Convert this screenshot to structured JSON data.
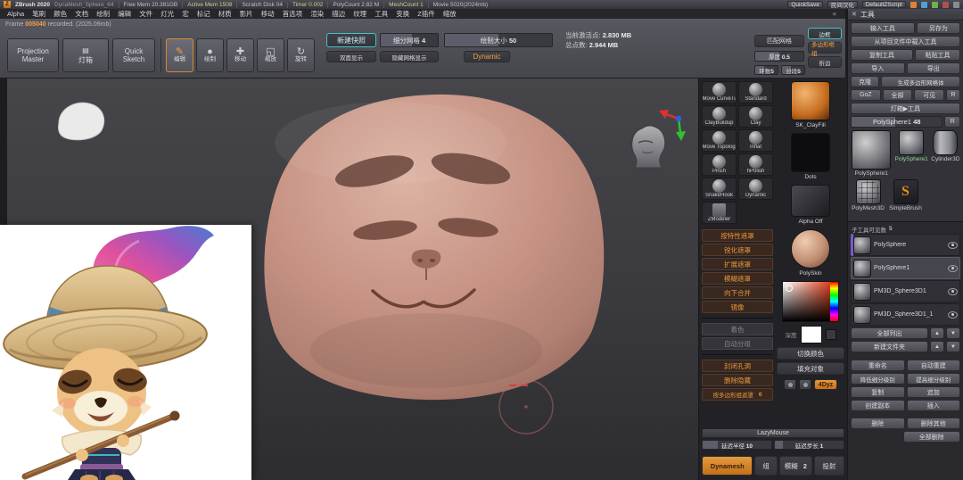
{
  "icons": {
    "logo": "Z",
    "close": "✕",
    "up": "▲",
    "down": "▼",
    "lightbox": "▤",
    "menu_more": "≡"
  },
  "title_bar": {
    "app_title": "ZBrush 2020",
    "doc_name": "DynaMesh_Sphere_64",
    "stats": [
      "Free Mem 20.381GB",
      "Active Mem 1508",
      "Scratch Disk 04",
      "Timer 0.002",
      "PolyCount 2.82 M",
      "MeshCount 1",
      "Movie 5020(2024mb)"
    ],
    "quicksave": "QuickSave",
    "plugin": "民间汉化",
    "zscript": "DefaultZScript"
  },
  "menu_bar": {
    "items": [
      "Alpha",
      "笔刷",
      "颜色",
      "文档",
      "绘制",
      "编辑",
      "文件",
      "灯光",
      "宏",
      "标记",
      "材质",
      "影片",
      "移动",
      "首选项",
      "渲染",
      "描边",
      "纹理",
      "工具",
      "变换",
      "Z插件",
      "缩放"
    ]
  },
  "toolbar": {
    "frame_label": "Frame",
    "frame_value": "005040",
    "frame_suffix": "recorded. (2025.09mb)",
    "projection_master": "Projection Master",
    "lightbox": "灯箱",
    "quick_sketch": "Quick Sketch",
    "modes": [
      {
        "label": "编辑",
        "glyph": "✎"
      },
      {
        "label": "绘制",
        "glyph": "●"
      },
      {
        "label": "移动",
        "glyph": "✚"
      },
      {
        "label": "缩放",
        "glyph": "◱"
      },
      {
        "label": "旋转",
        "glyph": "↻"
      }
    ],
    "snapshot": "新建快照",
    "subdiv": "细分网格",
    "subdiv_value": "4",
    "double_sided": "双面显示",
    "hide_mesh": "隐藏网格显示",
    "draw_size": "绘制大小",
    "draw_size_value": "50",
    "dynamic": "Dynamic",
    "active_points": "当前激活点:",
    "active_points_value": "2.830 MB",
    "total_points": "总点数:",
    "total_points_value": "2.944 MB",
    "match_mesh": "匹配网格",
    "thickness": "厚度",
    "thickness_value": "0.5",
    "rings": "环数",
    "rings_value": "5",
    "segments": "分段",
    "segments_value": "5",
    "border": "边框",
    "polyframe": "多边形框组",
    "crease": "折边"
  },
  "brush_panel": {
    "brushes": [
      "Move CurveTube",
      "Standard",
      "ClayBuildup",
      "Clay",
      "Move Topological",
      "Inflat",
      "Pinch",
      "hPolish",
      "SnakeHook",
      "Dynamic",
      "ZModeler"
    ],
    "preview_name": "SK_ClayFill",
    "stroke_name": "Dots",
    "alpha_name": "Alpha Off",
    "material_name": "PolySkin",
    "rgb_label": "深度",
    "switch_color": "切换颜色",
    "fill_object": "填充对象",
    "quick_buttons": [
      "按特性遮罩",
      "锐化遮罩",
      "扩展遮罩",
      "模糊遮罩",
      "向下合并",
      "镜像"
    ],
    "disabled_buttons": [
      "着色",
      "自动分组"
    ],
    "geo_buttons": [
      "封闭孔洞",
      "删除隐藏"
    ],
    "mask_group": "按多边形组遮罩",
    "mask_group_value": "0",
    "mini_orange": "4Dyz",
    "lazymouse": "LazyMouse",
    "lazy_radius": "延迟半径",
    "lazy_radius_value": "10",
    "lazy_step": "延迟步长",
    "lazy_step_value": "1",
    "dynamesh": "Dynamesh",
    "dm_group": "组",
    "dm_blur": "模糊",
    "d m_blur_value_unused": "",
    "dm_blur_value": "2",
    "dm_project": "投射"
  },
  "tool_panel": {
    "title": "工具",
    "load_tool": "输入工具",
    "save_as": "另存为",
    "load_from_project": "从项目文件中载入工具",
    "copy_tool": "复制工具",
    "paste_tool": "粘贴工具",
    "import": "导入",
    "export": "导出",
    "clone": "克隆",
    "make_polymesh": "生成多边形网格体",
    "goz": "GoZ",
    "all": "全部",
    "visible": "可见",
    "r": "R",
    "lightbox_tool": "灯箱▶工具",
    "active_tool": "PolySphere1",
    "active_tool_value": "48",
    "r2": "R",
    "tools": [
      "PolySphere1",
      "PolySphere1",
      "Cylinder3D",
      "PolyMesh3D",
      "SimpleBrush"
    ],
    "simple_brush_glyph": "S",
    "subtool_header": "子工具可见数",
    "subtool_header_value": "5",
    "subtools": [
      "PolySphere",
      "PolySphere1",
      "PM3D_Sphere3D1",
      "PM3D_Sphere3D1_1"
    ],
    "list_all": "全部列出",
    "new_folder": "新建文件夹",
    "btn_rows": [
      {
        "l": "重命名",
        "r": "自动重建"
      },
      {
        "l": "降低细分级别",
        "r": "提高细分级别"
      },
      {
        "l": "复制",
        "r": "追加"
      },
      {
        "l": "创建副本",
        "r": "插入"
      },
      {
        "l": "删除",
        "r": "删除其他"
      },
      {
        "r": "全部删除"
      }
    ]
  }
}
